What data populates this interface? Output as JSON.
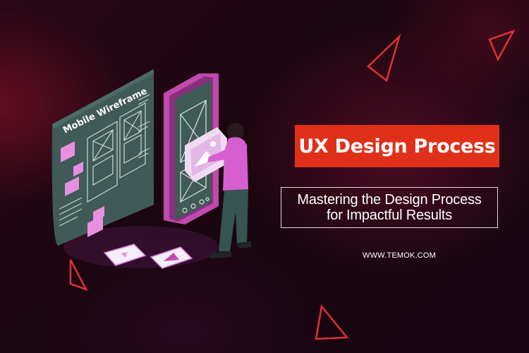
{
  "banner": {
    "title": "UX Design Process",
    "subtitle_line1": "Mastering the Design Process",
    "subtitle_line2": "for Impactful Results",
    "website": "WWW.TEMOK.COM"
  },
  "illustration": {
    "wireframe_label": "Mobile Wireframe"
  },
  "colors": {
    "accent": "#e0301a",
    "phone": "#c04aae",
    "wireframe_panel": "#3f5a57",
    "card": "#e88fe0"
  }
}
